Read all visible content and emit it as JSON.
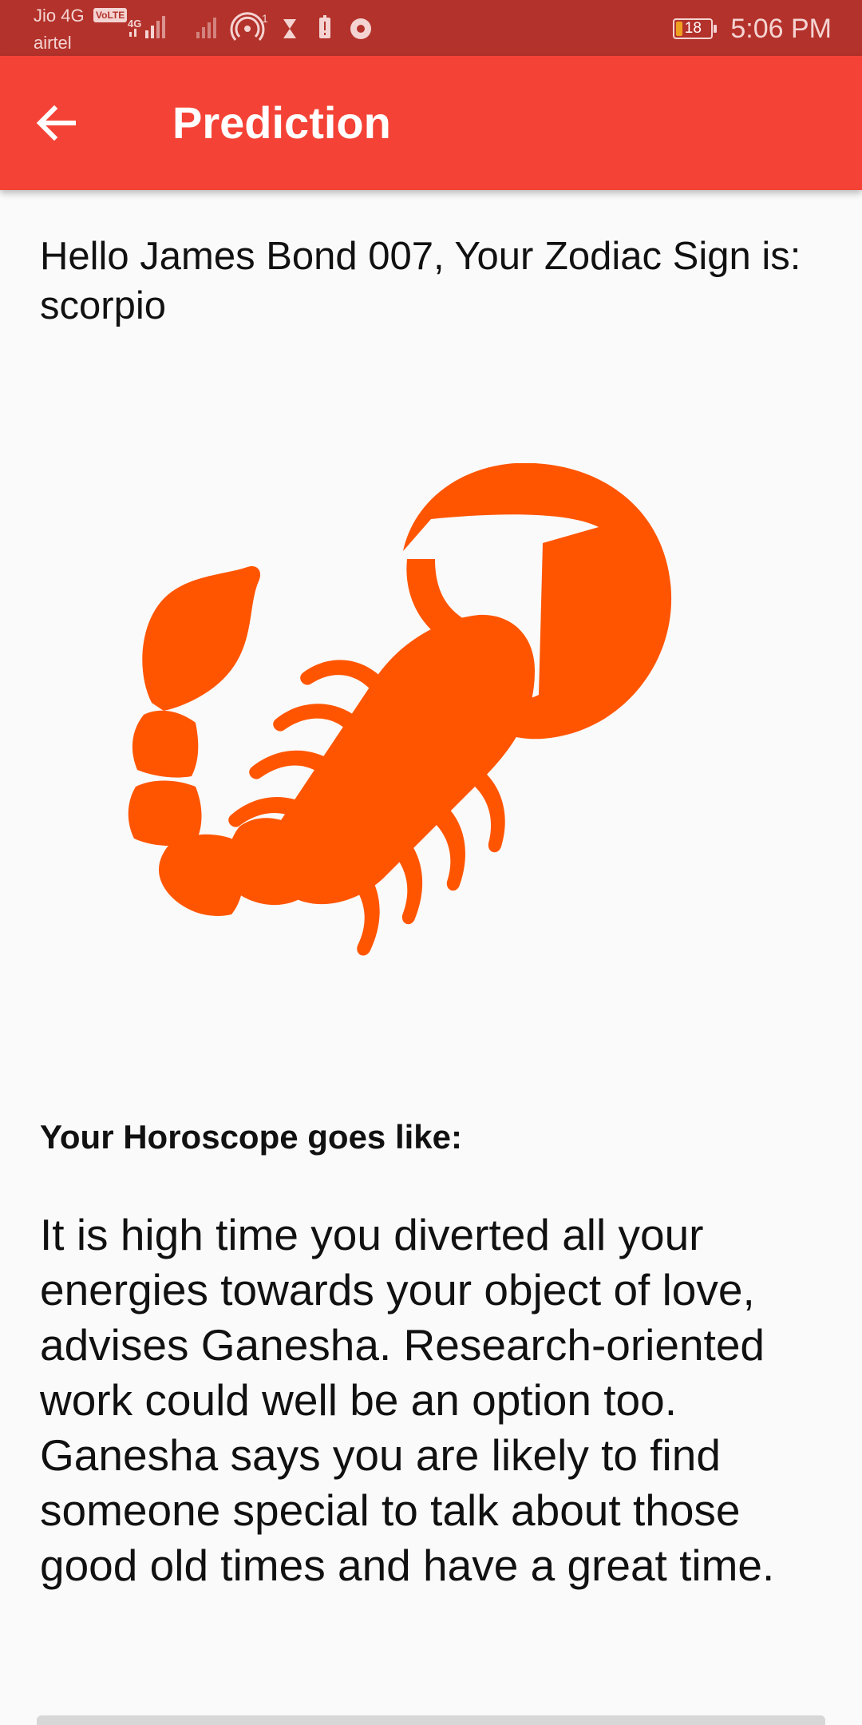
{
  "status_bar": {
    "carrier_1": "Jio 4G",
    "volte_badge": "VoLTE",
    "carrier_2": "airtel",
    "battery_level": "18",
    "battery_fraction": 0.18,
    "time": "5:06 PM",
    "icons": [
      "signal-icon",
      "signal-icon",
      "hotspot-icon",
      "hourglass-icon",
      "battery-alert-icon",
      "chrome-icon"
    ]
  },
  "app_bar": {
    "title": "Prediction",
    "back_icon": "arrow-back-icon",
    "color": "#f44336"
  },
  "content": {
    "greeting": "Hello James Bond 007, Your Zodiac Sign is: scorpio",
    "image_icon": "scorpio-icon",
    "image_color": "#ff5500",
    "horoscope_heading": "Your Horoscope goes like:",
    "horoscope_text": "It is high time you diverted all your energies towards your object of love, advises Ganesha. Research-oriented work could well be an option too. Ganesha says you are likely to find someone special to talk about those good old times and have a great time."
  }
}
